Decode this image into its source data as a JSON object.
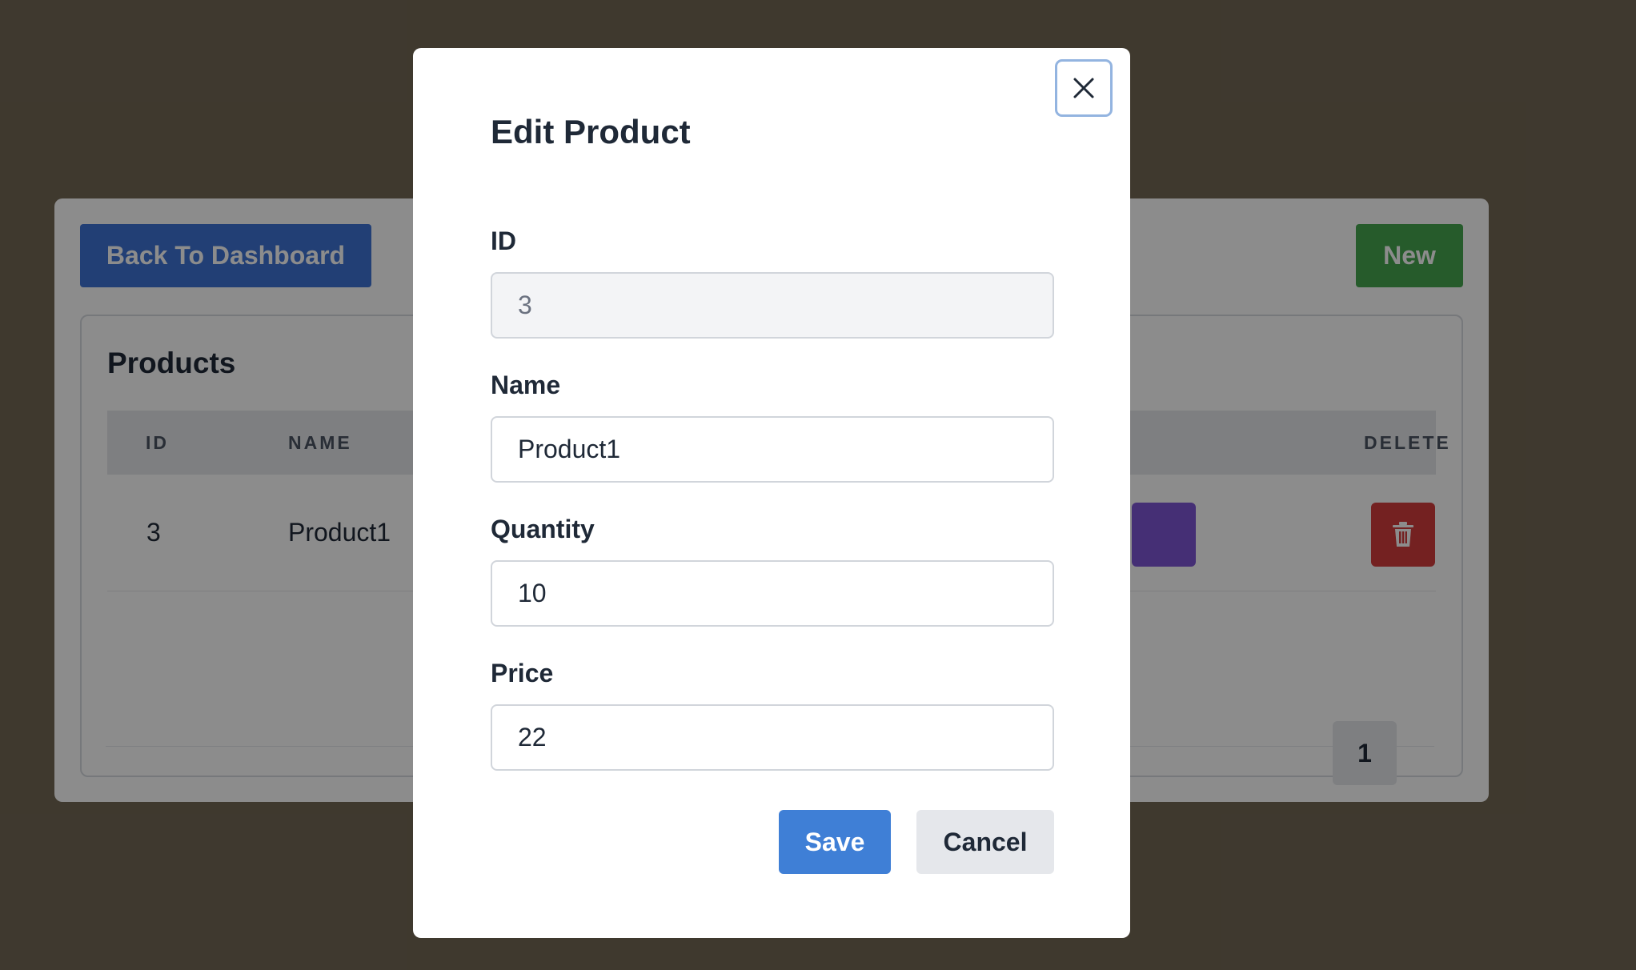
{
  "background_page": {
    "back_button_label": "Back To Dashboard",
    "new_button_label": "New",
    "products_title": "Products",
    "table": {
      "headers": [
        "ID",
        "NAME",
        "DELETE"
      ],
      "rows": [
        {
          "id": "3",
          "name": "Product1"
        }
      ]
    },
    "pagination_page": "1"
  },
  "modal": {
    "title": "Edit Product",
    "fields": {
      "id": {
        "label": "ID",
        "value": "3"
      },
      "name": {
        "label": "Name",
        "value": "Product1"
      },
      "quantity": {
        "label": "Quantity",
        "value": "10"
      },
      "price": {
        "label": "Price",
        "value": "22"
      }
    },
    "save_label": "Save",
    "cancel_label": "Cancel"
  },
  "icons": {
    "close": "close-icon",
    "delete": "trash-icon"
  },
  "colors": {
    "primary": "#3f74d6",
    "success": "#45a74f",
    "danger": "#d33d3d",
    "edit": "#7e57d6"
  }
}
